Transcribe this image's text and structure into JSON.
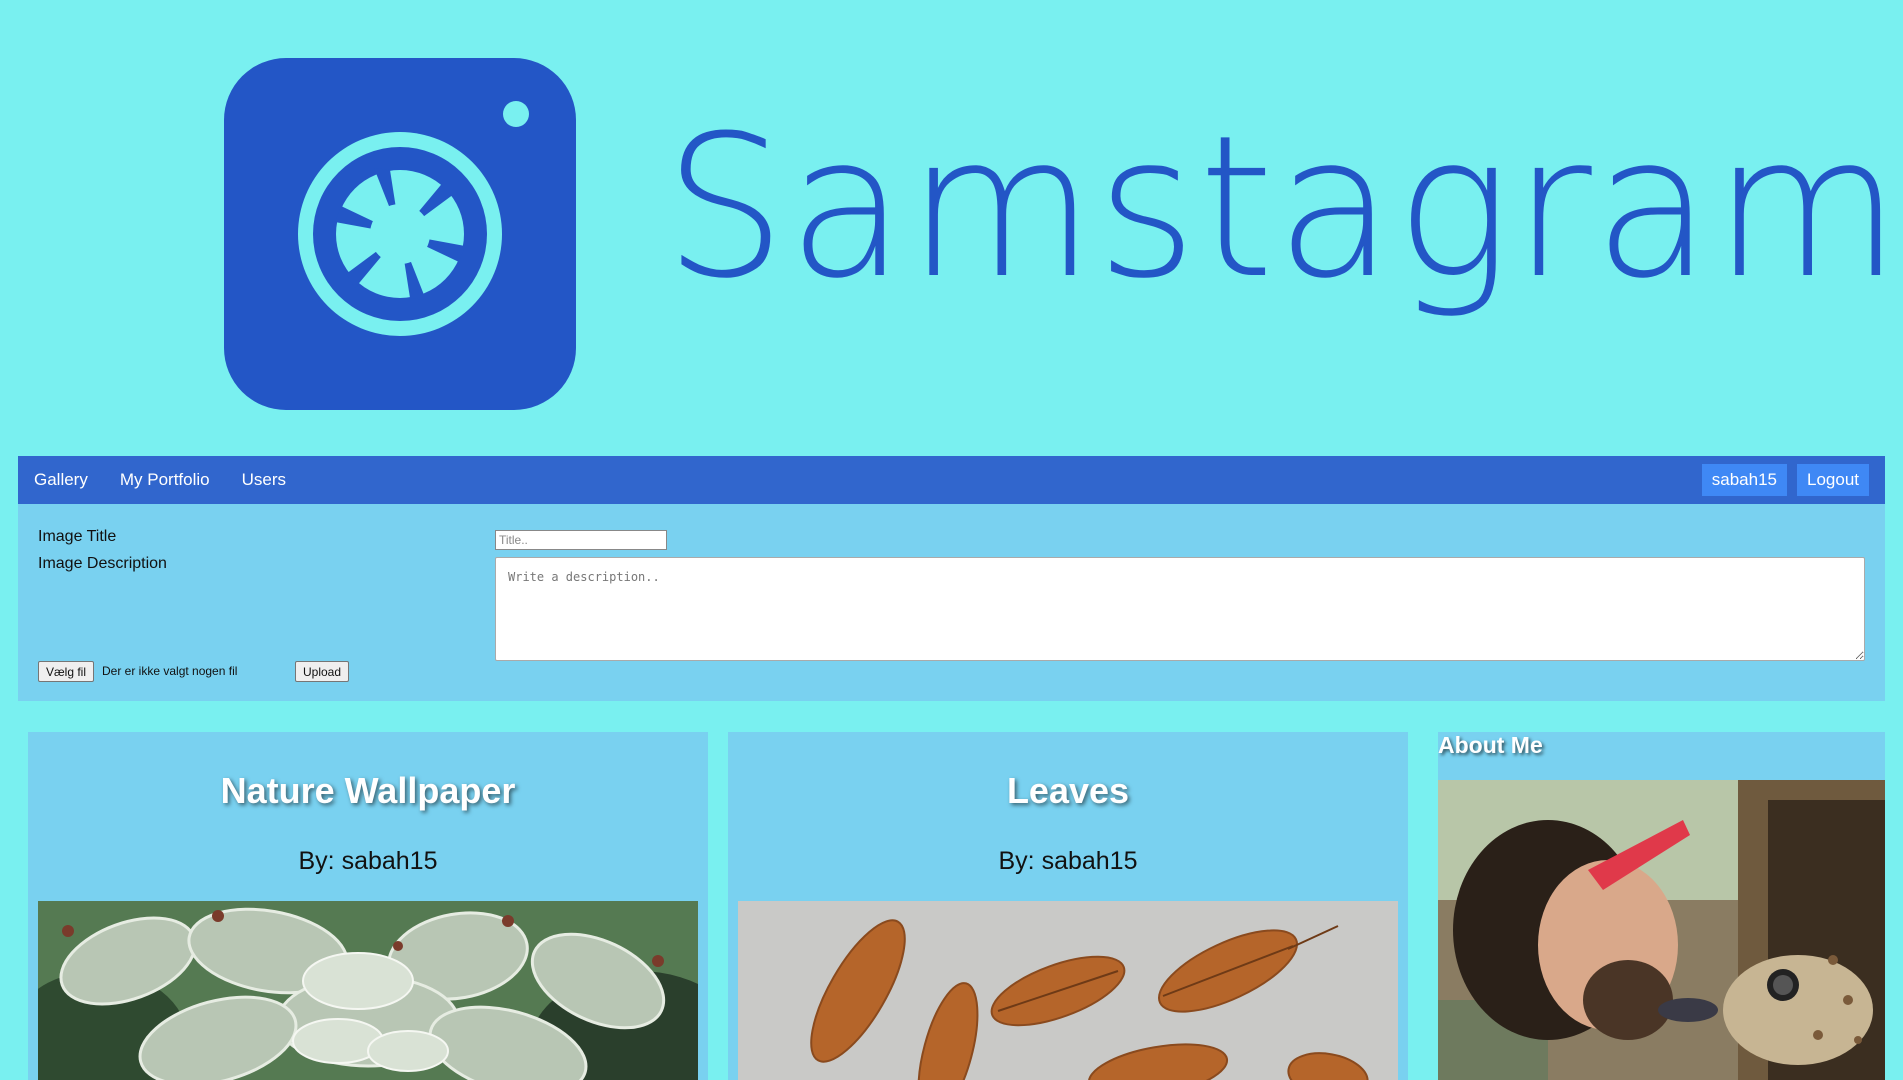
{
  "brand": {
    "name": "Samstagram",
    "logo_color": "#2356c6",
    "accent_color": "#79f0f0"
  },
  "nav": {
    "links": [
      {
        "label": "Gallery"
      },
      {
        "label": "My Portfolio"
      },
      {
        "label": "Users"
      }
    ],
    "user_label": "sabah15",
    "logout_label": "Logout"
  },
  "upload_form": {
    "title_label": "Image Title",
    "title_placeholder": "Title..",
    "description_label": "Image Description",
    "description_placeholder": "Write a description..",
    "file_button_label": "Vælg fil",
    "file_status": "Der er ikke valgt nogen fil",
    "upload_button_label": "Upload"
  },
  "gallery": {
    "cards": [
      {
        "title": "Nature Wallpaper",
        "author": "By: sabah15",
        "image_icon": "succulent-image"
      },
      {
        "title": "Leaves",
        "author": "By: sabah15",
        "image_icon": "leaves-image"
      }
    ]
  },
  "about": {
    "title": "About Me",
    "photo_icon": "profile-photo"
  }
}
